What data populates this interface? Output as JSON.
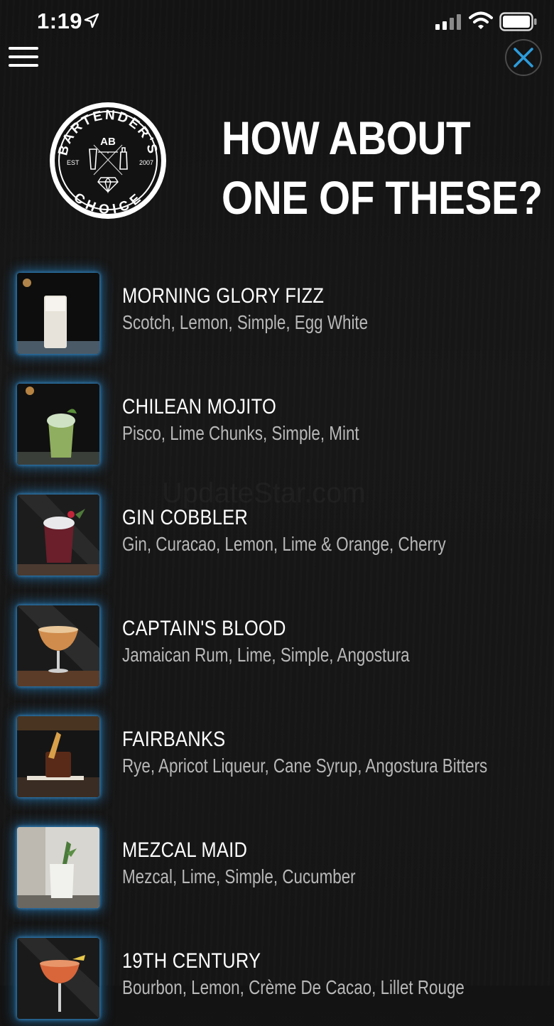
{
  "status_bar": {
    "time": "1:19"
  },
  "header": {
    "headline_line1": "HOW ABOUT",
    "headline_line2": "ONE OF THESE?"
  },
  "logo": {
    "top_text": "BARTENDER'S",
    "monogram": "AB",
    "left_text": "EST",
    "right_text": "2007",
    "bottom_text": "CHOICE"
  },
  "accent_color": "#2d9cdb",
  "drinks": [
    {
      "name": "MORNING GLORY FIZZ",
      "ingredients": "Scotch, Lemon, Simple, Egg White"
    },
    {
      "name": "CHILEAN MOJITO",
      "ingredients": "Pisco, Lime Chunks, Simple, Mint"
    },
    {
      "name": "GIN COBBLER",
      "ingredients": "Gin, Curacao, Lemon, Lime & Orange, Cherry"
    },
    {
      "name": "CAPTAIN'S BLOOD",
      "ingredients": "Jamaican Rum, Lime, Simple, Angostura"
    },
    {
      "name": "FAIRBANKS",
      "ingredients": "Rye, Apricot Liqueur, Cane Syrup, Angostura Bitters"
    },
    {
      "name": "MEZCAL MAID",
      "ingredients": "Mezcal, Lime, Simple, Cucumber"
    },
    {
      "name": "19TH CENTURY",
      "ingredients": "Bourbon, Lemon, Crème De Cacao, Lillet Rouge"
    }
  ],
  "watermark": "UpdateStar.com"
}
